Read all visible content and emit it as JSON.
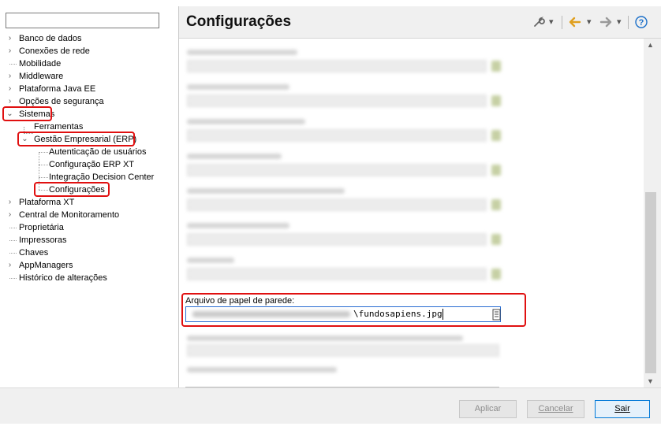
{
  "tree": {
    "filter_placeholder": "",
    "items": [
      {
        "label": "Banco de dados",
        "twisty": "›"
      },
      {
        "label": "Conexões de rede",
        "twisty": "›"
      },
      {
        "label": "Mobilidade",
        "twisty": ""
      },
      {
        "label": "Middleware",
        "twisty": "›"
      },
      {
        "label": "Plataforma Java EE",
        "twisty": "›"
      },
      {
        "label": "Opções de segurança",
        "twisty": "›"
      },
      {
        "label": "Sistemas",
        "twisty": "⌄"
      },
      {
        "label": "Ferramentas",
        "twisty": ""
      },
      {
        "label": "Gestão Empresarial (ERP)",
        "twisty": "⌄"
      },
      {
        "label": "Autenticação de usuários",
        "twisty": ""
      },
      {
        "label": "Configuração ERP XT",
        "twisty": ""
      },
      {
        "label": "Integração Decision Center",
        "twisty": ""
      },
      {
        "label": "Configurações",
        "twisty": ""
      },
      {
        "label": "Plataforma XT",
        "twisty": "›"
      },
      {
        "label": "Central de Monitoramento",
        "twisty": "›"
      },
      {
        "label": "Proprietária",
        "twisty": ""
      },
      {
        "label": "Impressoras",
        "twisty": ""
      },
      {
        "label": "Chaves",
        "twisty": ""
      },
      {
        "label": "AppManagers",
        "twisty": "›"
      },
      {
        "label": "Histórico de alterações",
        "twisty": ""
      }
    ]
  },
  "panel": {
    "title": "Configurações",
    "toolbar": {
      "wrench_icon": "wrench-icon",
      "back_icon": "back-arrow-icon",
      "forward_icon": "forward-arrow-icon",
      "help_icon": "help-icon",
      "dropdown": "▾",
      "help_glyph": "?"
    },
    "wallpaper_field": {
      "label": "Arquivo de papel de parede:",
      "value": "\\fundosapiens.jpg"
    }
  },
  "buttons": {
    "apply": "Aplicar",
    "cancel": "Cancelar",
    "exit": "Sair"
  },
  "colors": {
    "highlight": "#e01010",
    "focus": "#2a6dd2",
    "help": "#1a6fc9",
    "arrow": "#e0a020"
  }
}
